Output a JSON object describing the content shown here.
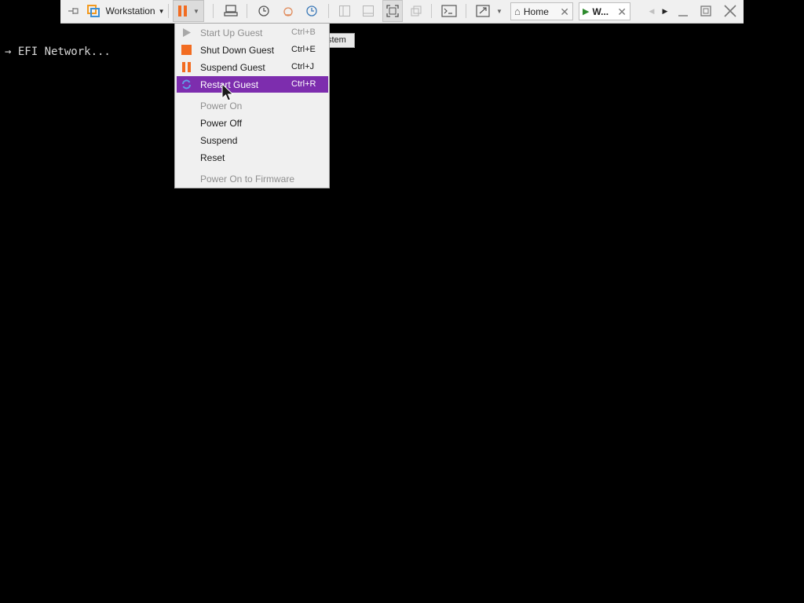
{
  "console": {
    "line": "→ EFI Network..."
  },
  "toolbar": {
    "workstation_label": "Workstation",
    "tabs": [
      {
        "label": "Home"
      },
      {
        "label": "W..."
      }
    ]
  },
  "tooltip": {
    "text": "stem"
  },
  "power_menu": {
    "items": [
      {
        "label": "Start Up Guest",
        "shortcut": "Ctrl+B",
        "enabled": false
      },
      {
        "label": "Shut Down Guest",
        "shortcut": "Ctrl+E",
        "enabled": true
      },
      {
        "label": "Suspend Guest",
        "shortcut": "Ctrl+J",
        "enabled": true
      },
      {
        "label": "Restart Guest",
        "shortcut": "Ctrl+R",
        "enabled": true,
        "highlighted": true
      },
      {
        "label": "Power On",
        "shortcut": "",
        "enabled": false
      },
      {
        "label": "Power Off",
        "shortcut": "",
        "enabled": true
      },
      {
        "label": "Suspend",
        "shortcut": "",
        "enabled": true
      },
      {
        "label": "Reset",
        "shortcut": "",
        "enabled": true
      },
      {
        "label": "Power On to Firmware",
        "shortcut": "",
        "enabled": false
      }
    ]
  },
  "colors": {
    "highlight": "#7d2dae",
    "accent_orange": "#f26c21",
    "toolbar_bg": "#f0f0f0",
    "screen_bg": "#000000"
  }
}
